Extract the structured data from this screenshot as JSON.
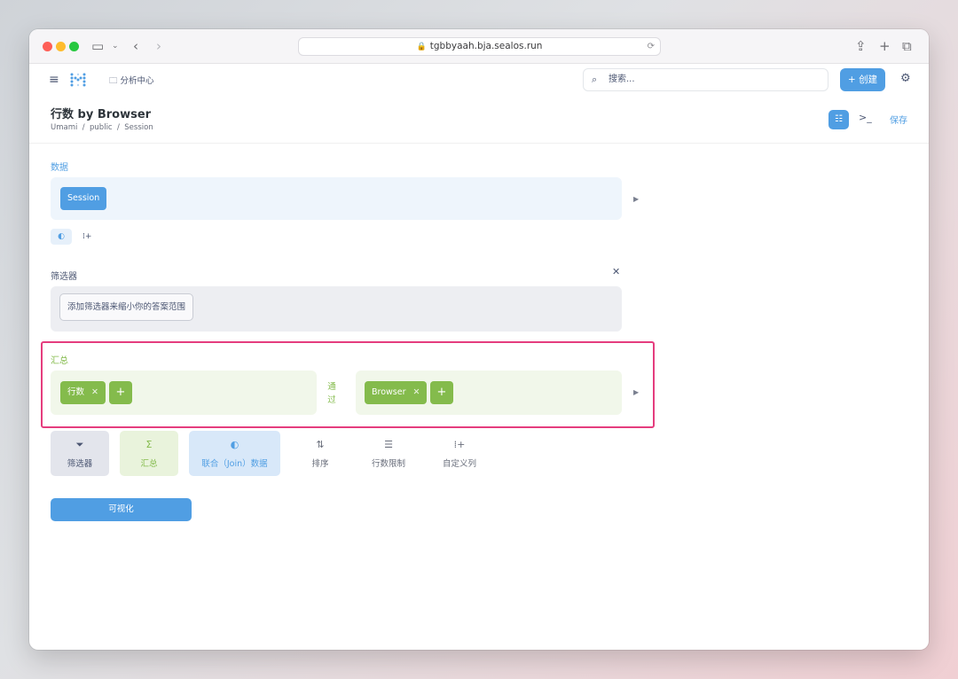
{
  "browser": {
    "url": "tgbbyaah.bja.sealos.run"
  },
  "header": {
    "collection": "分析中心",
    "search_placeholder": "搜索...",
    "create_label": "创建"
  },
  "question": {
    "title": "行数 by Browser",
    "breadcrumb": "Umami  /  public  /  Session",
    "save_label": "保存"
  },
  "data_section": {
    "label": "数据",
    "table": "Session"
  },
  "filter_section": {
    "label": "筛选器",
    "add_filter_label": "添加筛选器来缩小你的答案范围"
  },
  "summarize_section": {
    "label": "汇总",
    "metric": "行数",
    "by_label": "通\n过",
    "breakout": "Browser"
  },
  "steps": [
    {
      "icon": "filter-icon",
      "label": "筛选器"
    },
    {
      "icon": "sigma-icon",
      "label": "汇总"
    },
    {
      "icon": "join-icon",
      "label": "联合（Join）数据"
    },
    {
      "icon": "sort-icon",
      "label": "排序"
    },
    {
      "icon": "list-icon",
      "label": "行数限制"
    },
    {
      "icon": "custom-column-icon",
      "label": "自定义列"
    }
  ],
  "visualize_label": "可视化",
  "colors": {
    "brand": "#509ee3",
    "summarize": "#84bb4c",
    "highlight": "#e53d7e"
  }
}
